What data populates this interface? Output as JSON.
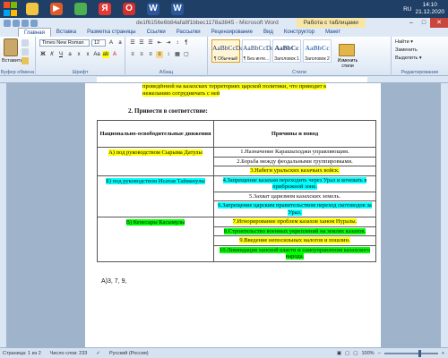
{
  "taskbar": {
    "icons": [
      {
        "name": "file-explorer-icon",
        "glyph": "",
        "color": "#f4c542"
      },
      {
        "name": "media-player-icon",
        "glyph": "▶",
        "color": "#e05a2a"
      },
      {
        "name": "chrome-icon",
        "glyph": "",
        "color": "#4caf50"
      },
      {
        "name": "yandex-icon",
        "glyph": "Я",
        "color": "#e53935"
      },
      {
        "name": "opera-icon",
        "glyph": "O",
        "color": "#d32f2f"
      },
      {
        "name": "word-icon",
        "glyph": "W",
        "color": "#2b579a"
      },
      {
        "name": "word-icon-2",
        "glyph": "W",
        "color": "#2b579a"
      }
    ],
    "lang": "RU",
    "time": "14:10",
    "date": "21.12.2020"
  },
  "titlebar": {
    "title": "de1f6156e6b84afa8f1bbec1178a3845 - Microsoft Word",
    "context_tab": "Работа с таблицами"
  },
  "ribbon_tabs": [
    "Главная",
    "Вставка",
    "Разметка страницы",
    "Ссылки",
    "Рассылки",
    "Рецензирование",
    "Вид",
    "Конструктор",
    "Макет"
  ],
  "ribbon": {
    "paste_label": "Вставить",
    "font_name": "Times New Roman",
    "font_size": "12",
    "groups": [
      "Буфер обмена",
      "Шрифт",
      "Абзац",
      "Стили",
      "Редактирование"
    ],
    "styles": [
      {
        "sample": "AaBbCcDd",
        "name": "¶ Обычный"
      },
      {
        "sample": "AaBbCcDd",
        "name": "¶ Без инте..."
      },
      {
        "sample": "AaBbCc",
        "name": "Заголовок 1"
      },
      {
        "sample": "AaBbCc",
        "name": "Заголовок 2"
      }
    ],
    "change_styles": "Изменить стили",
    "edit_items": [
      "Найти ▾",
      "Заменить",
      "Выделить ▾"
    ]
  },
  "document": {
    "prev_text_1": "проведённой на казахских территориях царской политики, что приводит к",
    "prev_text_2": "нежеланию сотрудничать с ней",
    "task_title": "2. Привести в соответствие:",
    "header_left": "Национально-освободительные движения",
    "header_right": "Причины и повод",
    "movements": [
      "А) под руководством Сырыма Датулы",
      "Б) под руководством Исатая Тайманулы",
      "В) Кенесары Касымулы"
    ],
    "causes": [
      "1.Назначение Карашыходжи управляющим.",
      "2.Борьба между феодальными группировками.",
      "3.Набеги уральских казачьих войск.",
      "4.Запрещение казахам переходить через Урал и кочевать в прибрежной зоне.",
      "5.Захват царизмом казахских земель.",
      "6.Запрещение царским правительством переход скотоводов за Урал.",
      "7.Игнорирование проблем казахов ханом Нуралы.",
      "8.Строительство военных укреплений на землях казахов.",
      "9.Введение непосильных налогов и пошлин.",
      "10.Ликвидация ханской власти и самоуправления казахского народа."
    ],
    "answer": "А)3, 7, 9,"
  },
  "statusbar": {
    "page": "Страница: 1 из 2",
    "words": "Число слов: 233",
    "lang": "Русский (Россия)",
    "zoom": "100%"
  },
  "colors": {
    "highlight_yellow": "#ffff00",
    "highlight_cyan": "#00ffff",
    "highlight_green": "#00ff00"
  }
}
